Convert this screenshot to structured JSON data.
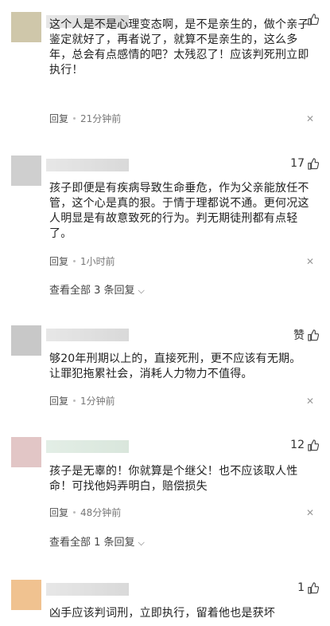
{
  "icons": {
    "thumb": "thumb-up-icon",
    "close": "close-icon",
    "chevron": "chevron-down-icon"
  },
  "comments": [
    {
      "text": "这个人是不是心理变态啊，是不是亲生的，做个亲子鉴定就好了，再者说了，就算不是亲生的，这么多年，总会有点感情的吧？太残忍了！应该判死刑立即执行！",
      "reply": "回复",
      "time": "21分钟前",
      "likes": "",
      "avatar_color": "#cfc7aa"
    },
    {
      "text": "孩子即便是有疾病导致生命垂危，作为父亲能放任不管，这个心是真的狠。于情于理都说不通。更何况这人明显是有故意致死的行为。判无期徒刑都有点轻了。",
      "reply": "回复",
      "time": "1小时前",
      "likes": "17",
      "avatar_color": "#cfcfcf",
      "more": "查看全部 3 条回复"
    },
    {
      "text": "够20年刑期以上的，直接死刑，更不应该有无期。让罪犯拖累社会，消耗人力物力不值得。",
      "reply": "回复",
      "time": "1分钟前",
      "likes": "赞",
      "avatar_color": "#c8c8c8"
    },
    {
      "text": "孩子是无辜的！你就算是个继父！也不应该取人性命！可找他妈弄明白，赔偿损失",
      "reply": "回复",
      "time": "48分钟前",
      "likes": "12",
      "avatar_color": "#e2c6c6",
      "more": "查看全部 1 条回复"
    },
    {
      "text": "凶手应该判词刑，立即执行，留着他也是获坏",
      "likes": "1",
      "avatar_color": "#f0c290"
    }
  ],
  "close_glyph": "✕",
  "chevron_glyph": "⌵"
}
